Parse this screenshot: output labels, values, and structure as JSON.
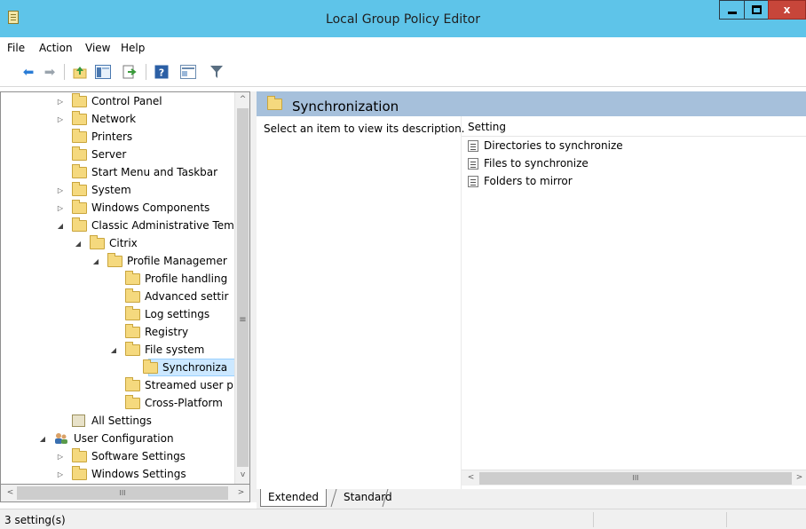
{
  "window": {
    "title": "Local Group Policy Editor",
    "close_glyph": "x"
  },
  "menu": [
    "File",
    "Action",
    "View",
    "Help"
  ],
  "toolbar": {
    "buttons": [
      "back-icon",
      "forward-icon",
      "up-folder-icon",
      "show-hide-tree-icon",
      "export-list-icon",
      "help-icon",
      "properties-view-icon",
      "filter-icon"
    ]
  },
  "tree": {
    "items": [
      {
        "label": "Control Panel",
        "expander": "▷"
      },
      {
        "label": "Network",
        "expander": "▷"
      },
      {
        "label": "Printers",
        "expander": ""
      },
      {
        "label": "Server",
        "expander": ""
      },
      {
        "label": "Start Menu and Taskbar",
        "expander": ""
      },
      {
        "label": "System",
        "expander": "▷"
      },
      {
        "label": "Windows Components",
        "expander": "▷"
      },
      {
        "label": "Classic Administrative Tem",
        "expander": "◢"
      },
      {
        "label": "Citrix",
        "expander": "◢"
      },
      {
        "label": "Profile Managemer",
        "expander": "◢"
      },
      {
        "label": "Profile handling",
        "expander": ""
      },
      {
        "label": "Advanced settir",
        "expander": ""
      },
      {
        "label": "Log settings",
        "expander": ""
      },
      {
        "label": "Registry",
        "expander": ""
      },
      {
        "label": "File system",
        "expander": "◢"
      },
      {
        "label": "Synchroniza",
        "expander": ""
      },
      {
        "label": "Streamed user p",
        "expander": ""
      },
      {
        "label": "Cross-Platform",
        "expander": ""
      },
      {
        "label": "All Settings",
        "expander": ""
      },
      {
        "label": "User Configuration",
        "expander": "◢"
      },
      {
        "label": "Software Settings",
        "expander": "▷"
      },
      {
        "label": "Windows Settings",
        "expander": "▷"
      }
    ],
    "scroll_grip": "≡",
    "hscroll_grip": "III"
  },
  "right": {
    "header_title": "Synchronization",
    "description": "Select an item to view its description.",
    "list_header": "Setting",
    "settings": [
      "Directories to synchronize",
      "Files to synchronize",
      "Folders to mirror"
    ],
    "hscroll_grip": "III"
  },
  "tabs": [
    "Extended",
    "Standard"
  ],
  "status": {
    "text": "3 setting(s)"
  },
  "colors": {
    "titlebar": "#5ec4e9",
    "header": "#a6c0db",
    "selection": "#cce8ff"
  }
}
